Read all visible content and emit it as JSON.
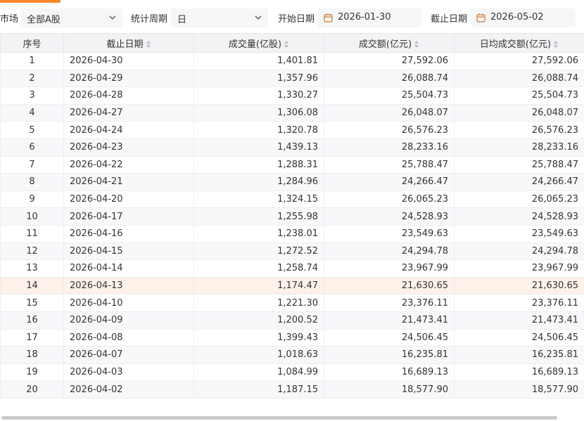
{
  "filters": {
    "market_label": "市场",
    "market_value": "全部A股",
    "period_label": "统计周期",
    "period_value": "日",
    "start_label": "开始日期",
    "start_value": "2026-01-30",
    "end_label": "截止日期",
    "end_value": "2026-05-02"
  },
  "colors": {
    "accent": "#f5892a",
    "highlight_row": "#fdf1ea"
  },
  "table": {
    "columns": [
      "序号",
      "截止日期",
      "成交量(亿股)",
      "成交额(亿元)",
      "日均成交额(亿元)"
    ],
    "highlighted_row": 14,
    "rows": [
      [
        "1",
        "2026-04-30",
        "1,401.81",
        "27,592.06",
        "27,592.06"
      ],
      [
        "2",
        "2026-04-29",
        "1,357.96",
        "26,088.74",
        "26,088.74"
      ],
      [
        "3",
        "2026-04-28",
        "1,330.27",
        "25,504.73",
        "25,504.73"
      ],
      [
        "4",
        "2026-04-27",
        "1,306.08",
        "26,048.07",
        "26,048.07"
      ],
      [
        "5",
        "2026-04-24",
        "1,320.78",
        "26,576.23",
        "26,576.23"
      ],
      [
        "6",
        "2026-04-23",
        "1,439.13",
        "28,233.16",
        "28,233.16"
      ],
      [
        "7",
        "2026-04-22",
        "1,288.31",
        "25,788.47",
        "25,788.47"
      ],
      [
        "8",
        "2026-04-21",
        "1,284.96",
        "24,266.47",
        "24,266.47"
      ],
      [
        "9",
        "2026-04-20",
        "1,324.15",
        "26,065.23",
        "26,065.23"
      ],
      [
        "10",
        "2026-04-17",
        "1,255.98",
        "24,528.93",
        "24,528.93"
      ],
      [
        "11",
        "2026-04-16",
        "1,238.01",
        "23,549.63",
        "23,549.63"
      ],
      [
        "12",
        "2026-04-15",
        "1,272.52",
        "24,294.78",
        "24,294.78"
      ],
      [
        "13",
        "2026-04-14",
        "1,258.74",
        "23,967.99",
        "23,967.99"
      ],
      [
        "14",
        "2026-04-13",
        "1,174.47",
        "21,630.65",
        "21,630.65"
      ],
      [
        "15",
        "2026-04-10",
        "1,221.30",
        "23,376.11",
        "23,376.11"
      ],
      [
        "16",
        "2026-04-09",
        "1,200.52",
        "21,473.41",
        "21,473.41"
      ],
      [
        "17",
        "2026-04-08",
        "1,399.43",
        "24,506.45",
        "24,506.45"
      ],
      [
        "18",
        "2026-04-07",
        "1,018.63",
        "16,235.81",
        "16,235.81"
      ],
      [
        "19",
        "2026-04-03",
        "1,084.99",
        "16,689.13",
        "16,689.13"
      ],
      [
        "20",
        "2026-04-02",
        "1,187.15",
        "18,577.90",
        "18,577.90"
      ]
    ]
  }
}
